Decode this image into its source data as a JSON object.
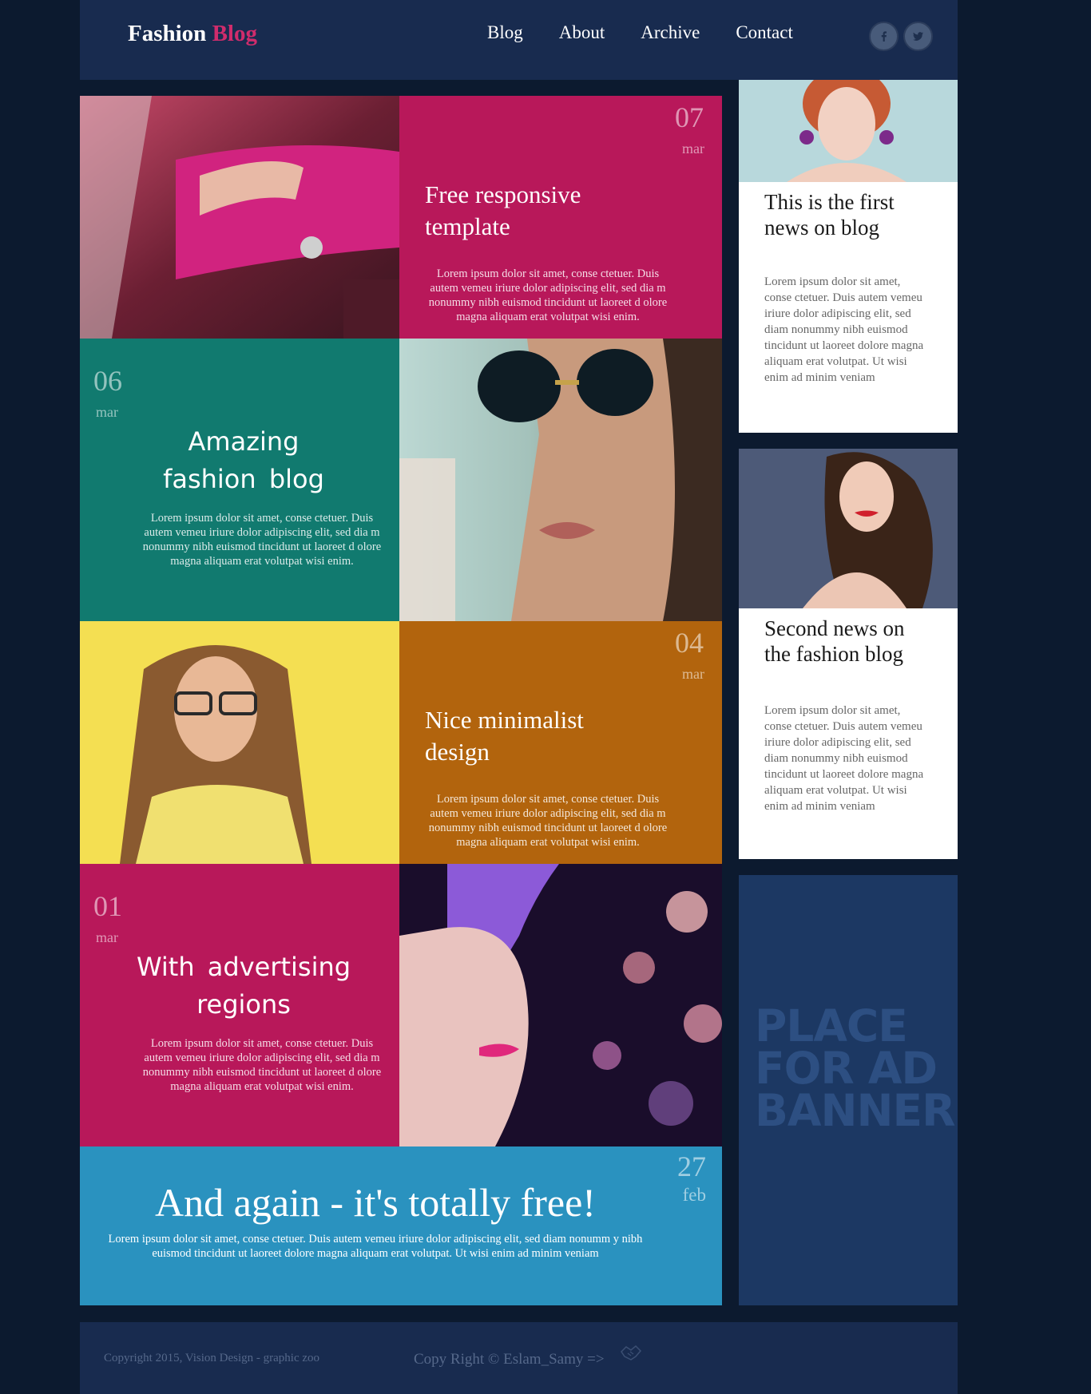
{
  "header": {
    "logo_main": "Fashion",
    "logo_accent": "Blog",
    "nav": [
      "Blog",
      "About",
      "Archive",
      "Contact"
    ],
    "social": [
      {
        "label": "f",
        "icon": "facebook-icon"
      },
      {
        "label": "t",
        "icon": "twitter-icon"
      }
    ]
  },
  "posts": [
    {
      "day": "07",
      "month": "mar",
      "title": "Free responsive template",
      "body": "Lorem ipsum dolor sit amet, conse ctetuer. Duis autem vemeu iriure dolor adipiscing elit, sed dia m nonummy nibh euismod tincidunt ut laoreet d olore magna aliquam erat volutpat wisi enim.",
      "color": "#b8185a"
    },
    {
      "day": "06",
      "month": "mar",
      "title": "Amazing fashion blog",
      "body": "Lorem ipsum dolor sit amet, conse ctetuer. Duis autem vemeu iriure dolor adipiscing elit, sed dia m nonummy nibh euismod tincidunt ut laoreet d olore magna aliquam erat volutpat wisi enim.",
      "color": "#117a6f"
    },
    {
      "day": "04",
      "month": "mar",
      "title": "Nice minimalist design",
      "body": "Lorem ipsum dolor sit amet, conse ctetuer. Duis autem vemeu iriure dolor adipiscing elit, sed dia m nonummy nibh euismod tincidunt ut laoreet d olore magna aliquam erat volutpat wisi enim.",
      "color": "#b2640d"
    },
    {
      "day": "01",
      "month": "mar",
      "title": "With advertising regions",
      "body": "Lorem ipsum dolor sit amet, conse ctetuer. Duis autem vemeu iriure dolor adipiscing elit, sed dia m nonummy nibh euismod tincidunt ut laoreet d olore magna aliquam erat volutpat wisi enim.",
      "color": "#b8185a"
    },
    {
      "day": "27",
      "month": "feb",
      "title": "And again - it's totally free!",
      "body": "Lorem ipsum dolor sit amet, conse ctetuer. Duis autem vemeu iriure dolor adipiscing elit, sed diam nonumm y nibh euismod tincidunt ut laoreet dolore magna aliquam erat volutpat. Ut wisi enim ad minim veniam",
      "color": "#2a92bf"
    }
  ],
  "sidebar": {
    "news": [
      {
        "title": "This is the first news on blog",
        "body": "Lorem ipsum dolor sit amet, conse ctetuer. Duis autem vemeu iriure dolor adipiscing elit, sed diam nonummy nibh euismod tincidunt ut laoreet dolore magna aliquam erat volutpat. Ut wisi enim ad minim veniam"
      },
      {
        "title": "Second news on the fashion blog",
        "body": "Lorem ipsum dolor sit amet, conse ctetuer. Duis autem vemeu iriure dolor adipiscing elit, sed diam nonummy nibh euismod tincidunt ut laoreet dolore magna aliquam erat volutpat. Ut wisi enim ad minim veniam"
      }
    ],
    "ad_text": "PLACE FOR AD BANNER"
  },
  "footer": {
    "copyright": "Copyright 2015, Vision Design - graphic zoo",
    "credit": "Copy Right © Eslam_Samy =>"
  }
}
